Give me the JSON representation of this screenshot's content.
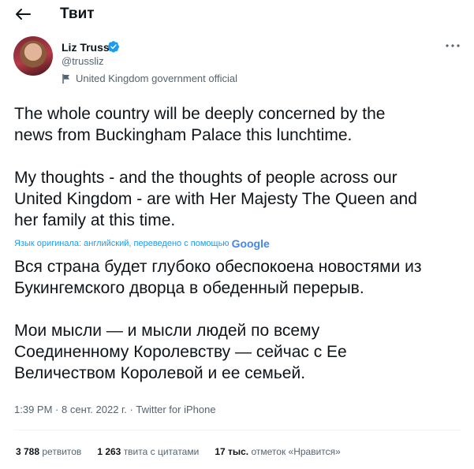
{
  "header": {
    "title": "Твит"
  },
  "author": {
    "name": "Liz Truss",
    "handle": "@trussliz",
    "label": "United Kingdom government official"
  },
  "tweet": {
    "text": "The whole country will be deeply concerned by the\nnews from Buckingham Palace this lunchtime.\n\nMy thoughts - and the thoughts of people across our\nUnited Kingdom - are with Her Majesty The Queen and\nher family at this time.",
    "translation_note": "Язык оригинала: английский, переведено с помощью",
    "translation_provider": "Google",
    "translated_text": "Вся страна будет глубоко обеспокоена новостями из\nБукингемского дворца в обеденный перерыв.\n\nМои мысли — и мысли людей по всему\nСоединенному Королевству — сейчас с Ее\nВеличеством Королевой и ее семьей.",
    "time": "1:39 PM",
    "date": "8 сент. 2022 г.",
    "source": "Twitter for iPhone",
    "separator": "·"
  },
  "stats": [
    {
      "count": "3 788",
      "label": "ретвитов"
    },
    {
      "count": "1 263",
      "label": "твита с цитатами"
    },
    {
      "count": "17 тыс.",
      "label": "отметок «Нравится»"
    }
  ],
  "colors": {
    "accent": "#1d9bf0",
    "muted": "#536471",
    "text": "#0f1419",
    "divider": "#eff3f4"
  },
  "icons": {
    "back": "arrow-left-icon",
    "verified": "verified-badge-icon",
    "label": "government-flag-icon",
    "more": "more-dots-icon"
  }
}
